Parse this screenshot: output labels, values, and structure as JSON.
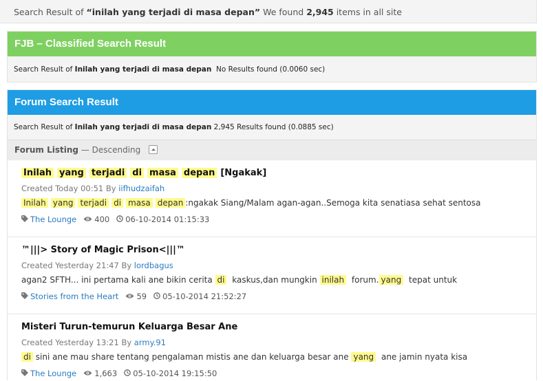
{
  "summary": {
    "prefix": "Search Result of ",
    "query_quoted": "“inilah yang terjadi di masa depan”",
    "middle": " We found ",
    "count": "2,945",
    "suffix": " items in all site"
  },
  "fjb": {
    "title": "FJB – Classified Search Result",
    "prefix": "Search Result of ",
    "query": "Inilah yang terjadi di masa depan",
    "result": "No Results found (0.0060 sec)"
  },
  "forum": {
    "title": "Forum Search Result",
    "prefix": "Search Result of ",
    "query": "Inilah yang terjadi di masa depan",
    "result": "2,945 Results found (0.0885 sec)"
  },
  "listing": {
    "label": "Forum Listing",
    "sort": "— Descending"
  },
  "results": [
    {
      "title_hl": [
        "Inilah",
        "yang",
        "terjadi",
        "di",
        "masa",
        "depan"
      ],
      "title_rest": "[Ngakak]",
      "created": "Created Today 00:51 By ",
      "author": "iifhudzaifah",
      "snippet_hl": [
        "Inilah",
        "yang",
        "terjadi",
        "di",
        "masa",
        "depan"
      ],
      "snippet_rest": ":ngakak Siang/Malam agan-agan..Semoga kita senatiasa sehat sentosa",
      "category": "The Lounge",
      "views": "400",
      "date": "06-10-2014 01:15:33"
    },
    {
      "title": "™|||> Story of Magic Prison<|||™",
      "created": "Created Yesterday 21:47 By ",
      "author": "lordbagus",
      "snippet": {
        "a": "agan2 SFTH... ini pertama kali ane bikin cerita ",
        "h1": "di",
        "b": " kaskus,dan mungkin ",
        "h2": "inilah",
        "c": " forum.",
        "h3": "yang",
        "d": " tepat untuk"
      },
      "category": "Stories from the Heart",
      "views": "59",
      "date": "05-10-2014 21:52:27"
    },
    {
      "title": "Misteri Turun-temurun Keluarga Besar Ane",
      "created": "Created Yesterday 13:21 By ",
      "author": "army.91",
      "snippet": {
        "h1": "di",
        "a": " sini ane mau share tentang pengalaman mistis ane dan keluarga besar ane ",
        "h2": "yang",
        "b": " ane jamin nyata kisa"
      },
      "category": "The Lounge",
      "views": "1,663",
      "date": "05-10-2014 19:15:50"
    }
  ],
  "colors": {
    "fjb_header": "#7ed160",
    "forum_header": "#1e9de4",
    "highlight": "#fffa8c",
    "link": "#2a7bbf"
  },
  "icons": {
    "tag": "tag-icon",
    "views": "eye-icon",
    "clock": "clock-icon",
    "collapse": "collapse-up-icon"
  }
}
